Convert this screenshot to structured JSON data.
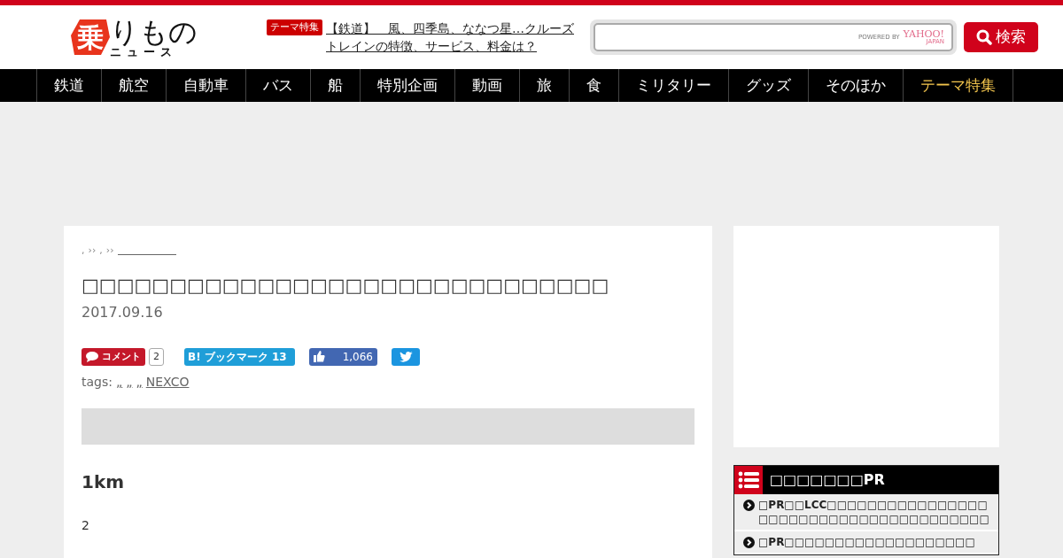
{
  "header": {
    "logo": {
      "mark": "乗",
      "name": "りもの",
      "sub": "ニュース"
    },
    "feature": {
      "badge": "テーマ特集",
      "link": "【鉄道】　風、四季島、ななつ星…クルーズトレインの特徴、サービス、料金は？"
    },
    "search": {
      "powered": "POWERED BY",
      "brand": "YAHOO!",
      "brand_sub": "JAPAN",
      "button": "検索"
    }
  },
  "nav": [
    {
      "label": "鉄道",
      "highlighted": false
    },
    {
      "label": "航空",
      "highlighted": false
    },
    {
      "label": "自動車",
      "highlighted": false
    },
    {
      "label": "バス",
      "highlighted": false
    },
    {
      "label": "船",
      "highlighted": false
    },
    {
      "label": "特別企画",
      "highlighted": false
    },
    {
      "label": "動画",
      "highlighted": false
    },
    {
      "label": "旅",
      "highlighted": false
    },
    {
      "label": "食",
      "highlighted": false
    },
    {
      "label": "ミリタリー",
      "highlighted": false
    },
    {
      "label": "グッズ",
      "highlighted": false
    },
    {
      "label": "そのほか",
      "highlighted": false
    },
    {
      "label": "テーマ特集",
      "highlighted": true
    }
  ],
  "article": {
    "breadcrumb": [
      ",",
      "››",
      ",",
      "››"
    ],
    "title": "□□□□□□□□□□□□□□□□□□□□□□□□□□□□□□",
    "date": "2017.09.16",
    "share": {
      "comment": "コメント",
      "comment_count": "2",
      "hatena_logo": "B!",
      "hatena": "ブックマーク",
      "hatena_count": "13",
      "like_count": "1,066"
    },
    "tags_label": "tags:",
    "tags": [
      "„",
      "„",
      "„",
      "NEXCO"
    ],
    "heading": "1km",
    "paragraph": "2"
  },
  "sidebar": {
    "widget_title": "□□□□□□□PR",
    "items": [
      "□PR□□LCC□□□□□□□□□□□□□□□□□□□□□□□□□□□□□□□□□□□□□□□",
      "□PR□□□□□□□□□□□□□□□□□□□"
    ]
  }
}
